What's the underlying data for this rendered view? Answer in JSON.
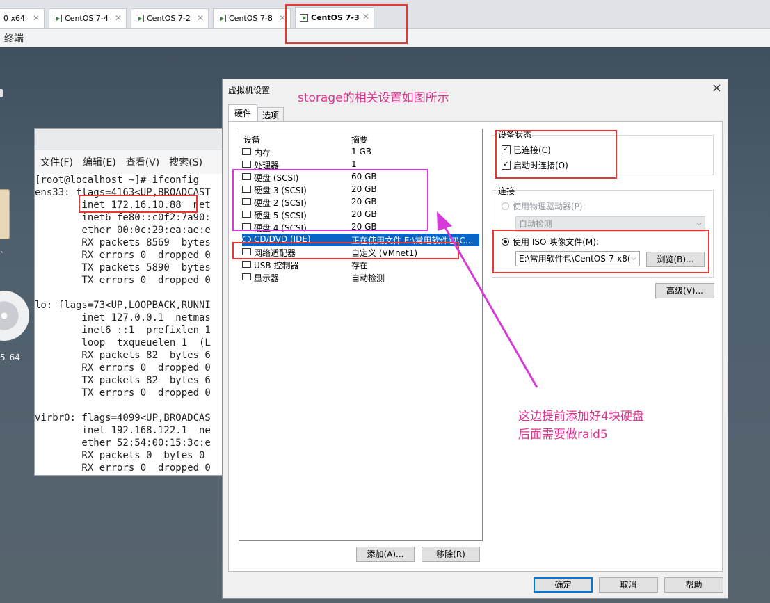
{
  "tabs": [
    {
      "label": "0 x64",
      "active": false
    },
    {
      "label": "CentOS 7-4",
      "active": false
    },
    {
      "label": "CentOS 7-2",
      "active": false
    },
    {
      "label": "CentOS 7-8",
      "active": false
    },
    {
      "label": "CentOS 7-3",
      "active": true
    }
  ],
  "menubar": {
    "label": "终端"
  },
  "desktop": {
    "iso_label": "5_64",
    "mark": "`"
  },
  "terminal": {
    "menu": [
      "文件(F)",
      "编辑(E)",
      "查看(V)",
      "搜索(S)"
    ],
    "lines": [
      "[root@localhost ~]# ifconfig",
      "ens33: flags=4163<UP,BROADCAST",
      "        inet 172.16.10.88  net",
      "        inet6 fe80::c0f2:7a90:",
      "        ether 00:0c:29:ea:ae:e",
      "        RX packets 8569  bytes",
      "        RX errors 0  dropped 0",
      "        TX packets 5890  bytes",
      "        TX errors 0  dropped 0",
      "",
      "lo: flags=73<UP,LOOPBACK,RUNNI",
      "        inet 127.0.0.1  netmas",
      "        inet6 ::1  prefixlen 1",
      "        loop  txqueuelen 1  (L",
      "        RX packets 82  bytes 6",
      "        RX errors 0  dropped 0",
      "        TX packets 82  bytes 6",
      "        TX errors 0  dropped 0",
      "",
      "virbr0: flags=4099<UP,BROADCAS",
      "        inet 192.168.122.1  ne",
      "        ether 52:54:00:15:3c:e",
      "        RX packets 0  bytes 0",
      "        RX errors 0  dropped 0"
    ]
  },
  "dialog": {
    "title": "虚拟机设置",
    "close": "×",
    "tabs": [
      "硬件",
      "选项"
    ],
    "list_header": {
      "device": "设备",
      "summary": "摘要"
    },
    "devices": [
      {
        "name": "内存",
        "summary": "1 GB",
        "icon": "memory-icon"
      },
      {
        "name": "处理器",
        "summary": "1",
        "icon": "cpu-icon"
      },
      {
        "name": "硬盘 (SCSI)",
        "summary": "60 GB",
        "icon": "disk-icon"
      },
      {
        "name": "硬盘 3 (SCSI)",
        "summary": "20 GB",
        "icon": "disk-icon"
      },
      {
        "name": "硬盘 2 (SCSI)",
        "summary": "20 GB",
        "icon": "disk-icon"
      },
      {
        "name": "硬盘 5 (SCSI)",
        "summary": "20 GB",
        "icon": "disk-icon"
      },
      {
        "name": "硬盘 4 (SCSI)",
        "summary": "20 GB",
        "icon": "disk-icon"
      },
      {
        "name": "CD/DVD (IDE)",
        "summary": "正在使用文件 E:\\常用软件包\\C...",
        "icon": "cd-icon",
        "selected": true
      },
      {
        "name": "网络适配器",
        "summary": "自定义 (VMnet1)",
        "icon": "network-icon"
      },
      {
        "name": "USB 控制器",
        "summary": "存在",
        "icon": "usb-icon"
      },
      {
        "name": "显示器",
        "summary": "自动检测",
        "icon": "monitor-icon"
      }
    ],
    "add_button": "添加(A)...",
    "remove_button": "移除(R)",
    "device_status": {
      "label": "设备状态",
      "connected": "已连接(C)",
      "connect_at_power_on": "启动时连接(O)"
    },
    "connection": {
      "label": "连接",
      "physical_drive": "使用物理驱动器(P):",
      "auto_detect": "自动检测",
      "use_iso": "使用 ISO 映像文件(M):",
      "iso_path": "E:\\常用软件包\\CentOS-7-x8(",
      "browse": "浏览(B)..."
    },
    "advanced": "高级(V)...",
    "ok": "确定",
    "cancel": "取消",
    "help": "帮助"
  },
  "annotations": {
    "storage_note": "storage的相关设置如图所示",
    "disk_note_1": "这边提前添加好4块硬盘",
    "disk_note_2": "后面需要做raid5",
    "colors": {
      "red": "#e53935",
      "pink": "#d63ad8",
      "note_text": "#e0338f",
      "selection": "#0a64c6"
    }
  }
}
